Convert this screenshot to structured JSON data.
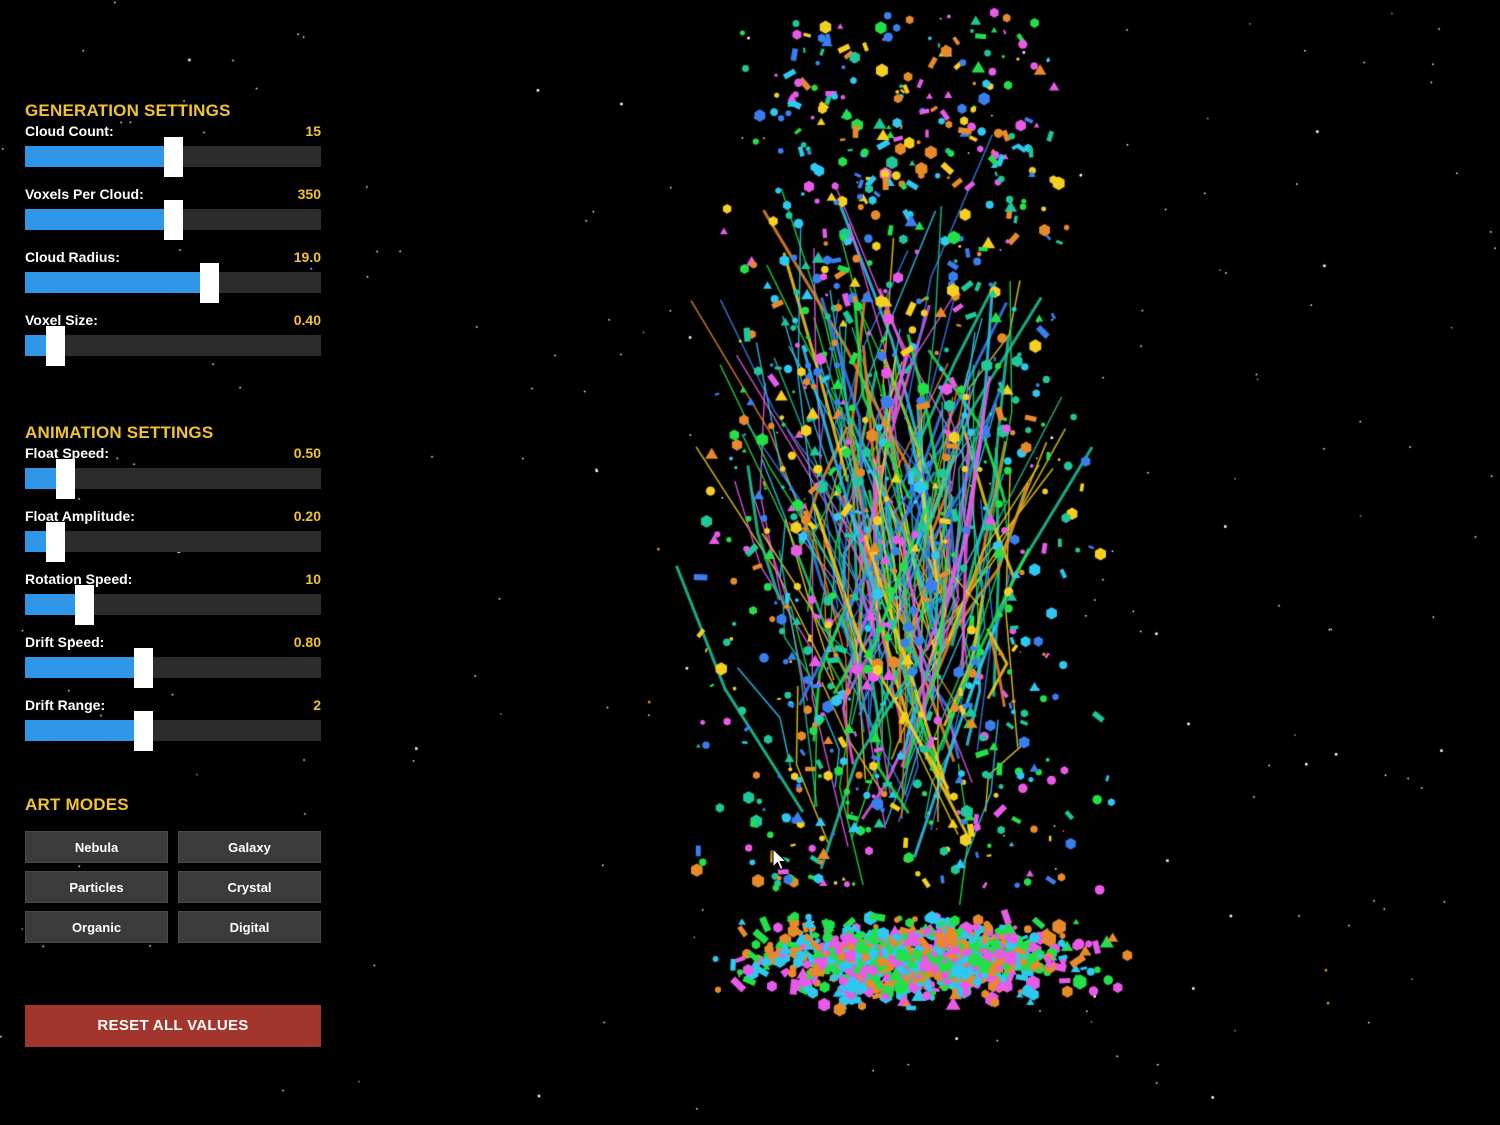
{
  "generation": {
    "title": "GENERATION SETTINGS",
    "sliders": [
      {
        "label": "Cloud Count:",
        "value": "15",
        "fraction": 0.5
      },
      {
        "label": "Voxels Per Cloud:",
        "value": "350",
        "fraction": 0.5
      },
      {
        "label": "Cloud Radius:",
        "value": "19.0",
        "fraction": 0.62
      },
      {
        "label": "Voxel Size:",
        "value": "0.40",
        "fraction": 0.1
      }
    ]
  },
  "animation": {
    "title": "ANIMATION SETTINGS",
    "sliders": [
      {
        "label": "Float Speed:",
        "value": "0.50",
        "fraction": 0.135
      },
      {
        "label": "Float Amplitude:",
        "value": "0.20",
        "fraction": 0.1
      },
      {
        "label": "Rotation Speed:",
        "value": "10",
        "fraction": 0.2
      },
      {
        "label": "Drift Speed:",
        "value": "0.80",
        "fraction": 0.4
      },
      {
        "label": "Drift Range:",
        "value": "2",
        "fraction": 0.4
      }
    ]
  },
  "art_modes": {
    "title": "ART MODES",
    "buttons": [
      "Nebula",
      "Galaxy",
      "Particles",
      "Crystal",
      "Organic",
      "Digital"
    ]
  },
  "reset": {
    "label": "RESET ALL VALUES"
  },
  "colors": {
    "accent_yellow": "#f2c230",
    "slider_fill": "#2f96e8",
    "reset_red": "#a2352c",
    "voxel_green": "#22e04a",
    "voxel_magenta": "#e85ae8",
    "voxel_cyan": "#2ec8f0",
    "voxel_orange": "#e88a2a",
    "voxel_teal": "#1fc79a"
  }
}
